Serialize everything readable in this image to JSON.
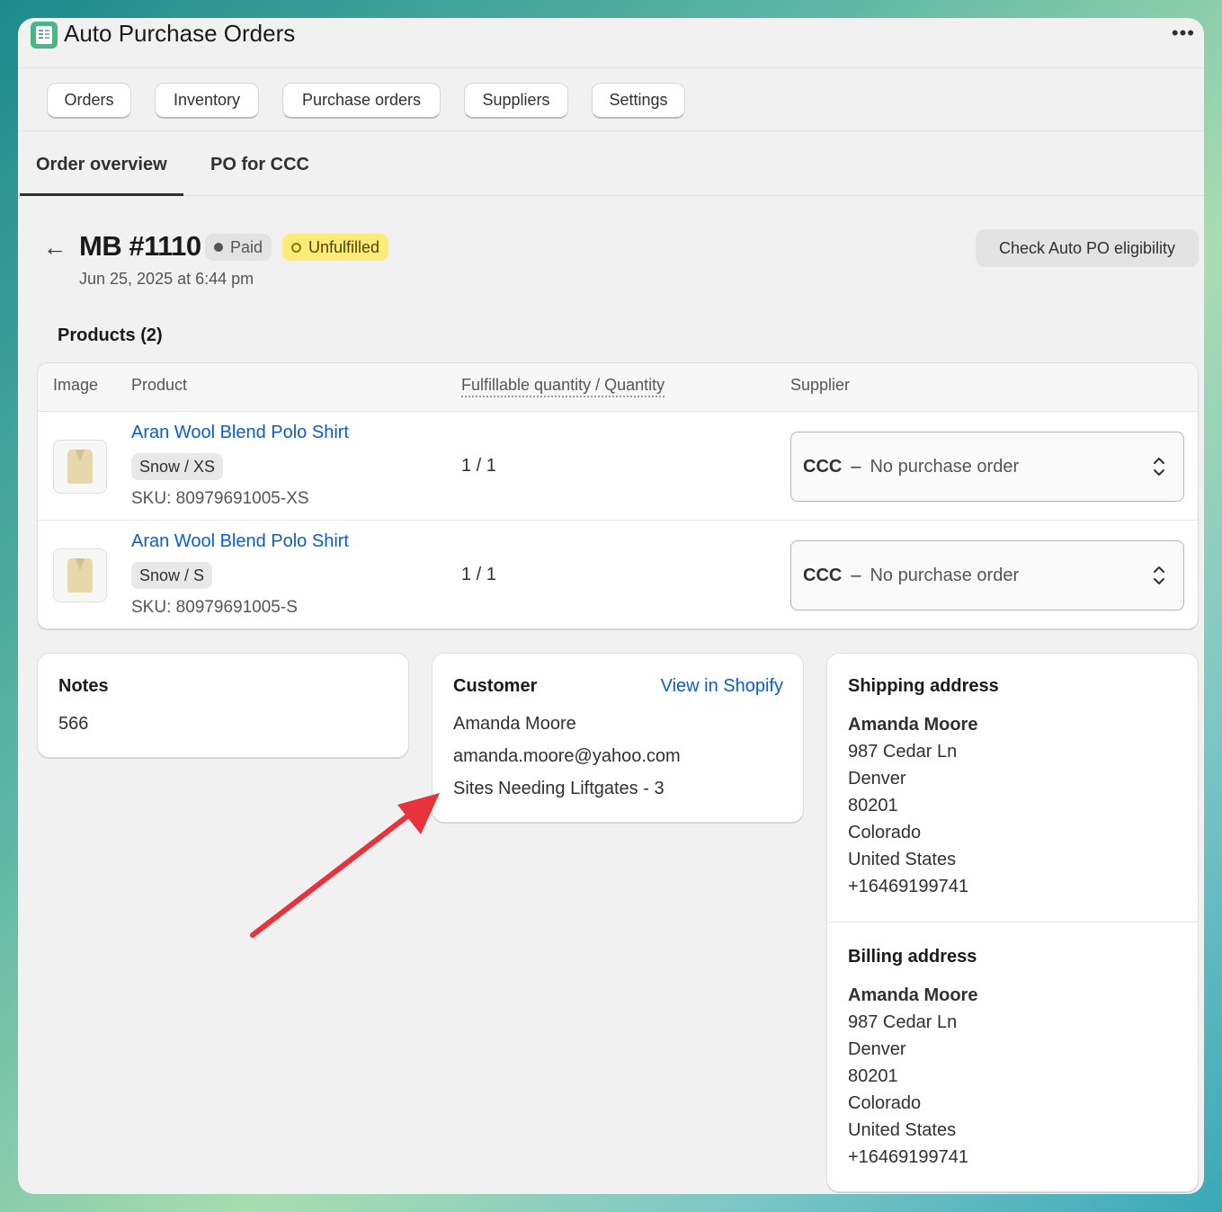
{
  "app": {
    "title": "Auto Purchase Orders",
    "icon": "spreadsheet-icon",
    "menu_glyph": "•••"
  },
  "nav": [
    "Orders",
    "Inventory",
    "Purchase orders",
    "Suppliers",
    "Settings"
  ],
  "tabs": {
    "active": "Order overview",
    "other": "PO for CCC"
  },
  "order": {
    "back_glyph": "←",
    "title": "MB #1110",
    "paid_badge": "Paid",
    "fulfillment_badge": "Unfulfilled",
    "date": "Jun 25, 2025 at 6:44 pm",
    "check_button": "Check Auto PO eligibility"
  },
  "products": {
    "title": "Products (2)",
    "headers": {
      "image": "Image",
      "product": "Product",
      "quantity": "Fulfillable quantity / Quantity",
      "supplier": "Supplier"
    },
    "rows": [
      {
        "name": "Aran Wool Blend Polo Shirt",
        "variant": "Snow / XS",
        "sku": "SKU: 80979691005-XS",
        "quantity": "1 / 1",
        "supplier": "CCC",
        "separator": "–",
        "po_status": "No purchase order"
      },
      {
        "name": "Aran Wool Blend Polo Shirt",
        "variant": "Snow / S",
        "sku": "SKU: 80979691005-S",
        "quantity": "1 / 1",
        "supplier": "CCC",
        "separator": "–",
        "po_status": "No purchase order"
      }
    ]
  },
  "notes": {
    "title": "Notes",
    "value": "566"
  },
  "customer": {
    "title": "Customer",
    "link": "View in Shopify",
    "name": "Amanda Moore",
    "email": "amanda.moore@yahoo.com",
    "extra": "Sites Needing Liftgates - 3"
  },
  "shipping": {
    "title": "Shipping address",
    "name": "Amanda Moore",
    "street": "987 Cedar Ln",
    "city": "Denver",
    "zip": "80201",
    "state": "Colorado",
    "country": "United States",
    "phone": "+16469199741"
  },
  "billing": {
    "title": "Billing address",
    "name": "Amanda Moore",
    "street": "987 Cedar Ln",
    "city": "Denver",
    "zip": "80201",
    "state": "Colorado",
    "country": "United States",
    "phone": "+16469199741"
  },
  "colors": {
    "link": "#0b5ccc",
    "unfulfilled_badge": "#ffeb78",
    "annotation_arrow": "#e8323c",
    "app_icon": "#4bb58a"
  }
}
